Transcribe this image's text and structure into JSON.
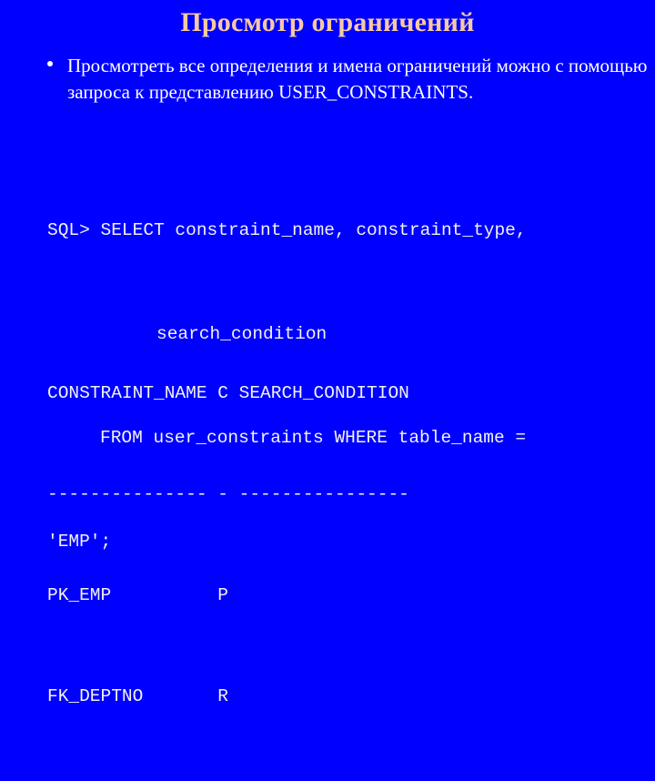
{
  "slide": {
    "title": "Просмотр ограничений",
    "background_color": "#0000FF",
    "title_color": "#F6C9A3",
    "body_color": "#FFFFFF",
    "bullets": [
      {
        "marker": "bullet-dot",
        "text": "Просмотреть все определения и имена ограничений можно с помощью запроса к представлению USER_CONSTRAINTS."
      }
    ],
    "code": {
      "lines": [
        "SQL> SELECT constraint_name, constraint_type,",
        "search_condition",
        "FROM user_constraints WHERE table_name =",
        "'EMP';"
      ],
      "line1": "SQL> SELECT constraint_name, constraint_type,",
      "line2": "search_condition",
      "line3": "FROM user_constraints WHERE table_name =",
      "line4": "'EMP';"
    },
    "result": {
      "header": "CONSTRAINT_NAME C SEARCH_CONDITION",
      "separator": "--------------- - ----------------",
      "rows": [
        "PK_EMP          P",
        "FK_DEPTNO       R"
      ],
      "row1": "PK_EMP          P",
      "row2": "FK_DEPTNO       R",
      "columns": [
        "CONSTRAINT_NAME",
        "C",
        "SEARCH_CONDITION"
      ],
      "data": [
        {
          "constraint_name": "PK_EMP",
          "c": "P",
          "search_condition": ""
        },
        {
          "constraint_name": "FK_DEPTNO",
          "c": "R",
          "search_condition": ""
        }
      ]
    }
  }
}
